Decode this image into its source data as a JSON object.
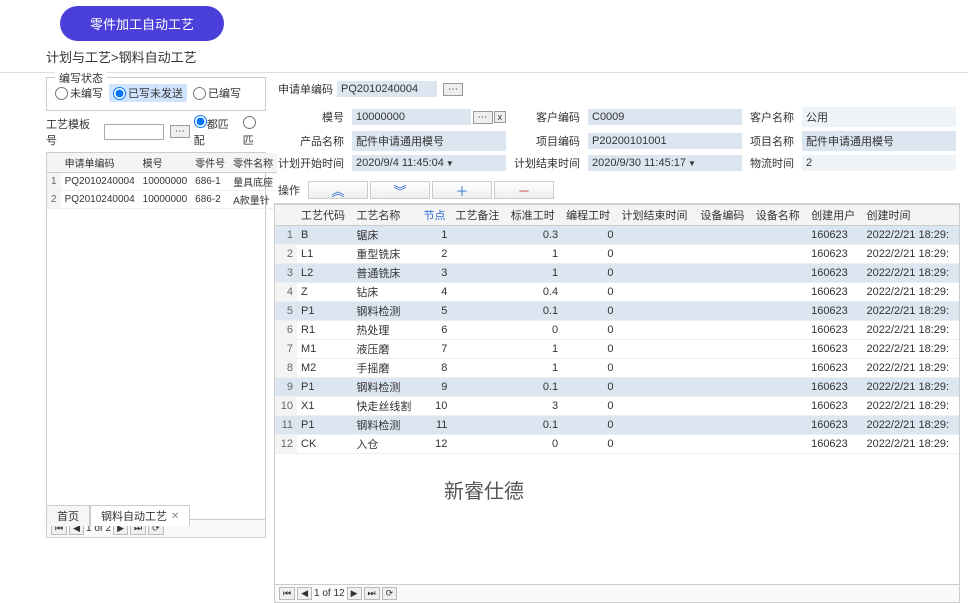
{
  "topButton": "零件加工自动工艺",
  "breadcrumb": "计划与工艺>钢料自动工艺",
  "leftPanel": {
    "statusTitle": "编写状态",
    "radios": {
      "unwritten": "未编写",
      "writtenNotSent": "已写未发送",
      "written": "已编写"
    },
    "filter": {
      "templateLabel": "工艺模板号",
      "matchAll": "都匹配",
      "other": "匹"
    },
    "columns": [
      "申请单编码",
      "模号",
      "零件号",
      "零件名称"
    ],
    "rows": [
      {
        "code": "PQ2010240004",
        "mold": "10000000",
        "part": "686-1",
        "name": "量具底座"
      },
      {
        "code": "PQ2010240004",
        "mold": "10000000",
        "part": "686-2",
        "name": "A款量针"
      }
    ],
    "pager": "1 of 2"
  },
  "form": {
    "reqCodeLabel": "申请单编码",
    "reqCode": "PQ2010240004",
    "moldLabel": "模号",
    "mold": "10000000",
    "custCodeLabel": "客户编码",
    "custCode": "C0009",
    "custNameLabel": "客户名称",
    "custName": "公用",
    "prodNameLabel": "产品名称",
    "prodName": "配件申请通用模号",
    "projCodeLabel": "项目编码",
    "projCode": "P20200101001",
    "projNameLabel": "项目名称",
    "projName": "配件申请通用模号",
    "planStartLabel": "计划开始时间",
    "planStart": "2020/9/4 11:45:04",
    "planEndLabel": "计划结束时间",
    "planEnd": "2020/9/30 11:45:17",
    "logisticsLabel": "物流时间",
    "logistics": "2"
  },
  "toolbar": {
    "opLabel": "操作"
  },
  "gridColumns": [
    "工艺代码",
    "工艺名称",
    "节点",
    "工艺备注",
    "标准工时",
    "编程工时",
    "计划结束时间",
    "设备编码",
    "设备名称",
    "创建用户",
    "创建时间"
  ],
  "gridRows": [
    {
      "alt": true,
      "code": "B",
      "name": "锯床",
      "node": "1",
      "remark": "",
      "std": "0.3",
      "prog": "0",
      "planEnd": "",
      "devCode": "",
      "devName": "",
      "user": "160623",
      "ctime": "2022/2/21 18:29:"
    },
    {
      "alt": false,
      "code": "L1",
      "name": "重型铣床",
      "node": "2",
      "remark": "",
      "std": "1",
      "prog": "0",
      "planEnd": "",
      "devCode": "",
      "devName": "",
      "user": "160623",
      "ctime": "2022/2/21 18:29:"
    },
    {
      "alt": true,
      "code": "L2",
      "name": "普通铣床",
      "node": "3",
      "remark": "",
      "std": "1",
      "prog": "0",
      "planEnd": "",
      "devCode": "",
      "devName": "",
      "user": "160623",
      "ctime": "2022/2/21 18:29:"
    },
    {
      "alt": false,
      "code": "Z",
      "name": "钻床",
      "node": "4",
      "remark": "",
      "std": "0.4",
      "prog": "0",
      "planEnd": "",
      "devCode": "",
      "devName": "",
      "user": "160623",
      "ctime": "2022/2/21 18:29:"
    },
    {
      "alt": true,
      "code": "P1",
      "name": "钢料检测",
      "node": "5",
      "remark": "",
      "std": "0.1",
      "prog": "0",
      "planEnd": "",
      "devCode": "",
      "devName": "",
      "user": "160623",
      "ctime": "2022/2/21 18:29:"
    },
    {
      "alt": false,
      "code": "R1",
      "name": "热处理",
      "node": "6",
      "remark": "",
      "std": "0",
      "prog": "0",
      "planEnd": "",
      "devCode": "",
      "devName": "",
      "user": "160623",
      "ctime": "2022/2/21 18:29:"
    },
    {
      "alt": false,
      "code": "M1",
      "name": "液压磨",
      "node": "7",
      "remark": "",
      "std": "1",
      "prog": "0",
      "planEnd": "",
      "devCode": "",
      "devName": "",
      "user": "160623",
      "ctime": "2022/2/21 18:29:"
    },
    {
      "alt": false,
      "code": "M2",
      "name": "手摇磨",
      "node": "8",
      "remark": "",
      "std": "1",
      "prog": "0",
      "planEnd": "",
      "devCode": "",
      "devName": "",
      "user": "160623",
      "ctime": "2022/2/21 18:29:"
    },
    {
      "alt": true,
      "code": "P1",
      "name": "钢料检测",
      "node": "9",
      "remark": "",
      "std": "0.1",
      "prog": "0",
      "planEnd": "",
      "devCode": "",
      "devName": "",
      "user": "160623",
      "ctime": "2022/2/21 18:29:"
    },
    {
      "alt": false,
      "code": "X1",
      "name": "快走丝线割",
      "node": "10",
      "remark": "",
      "std": "3",
      "prog": "0",
      "planEnd": "",
      "devCode": "",
      "devName": "",
      "user": "160623",
      "ctime": "2022/2/21 18:29:"
    },
    {
      "alt": true,
      "code": "P1",
      "name": "钢料检测",
      "node": "11",
      "remark": "",
      "std": "0.1",
      "prog": "0",
      "planEnd": "",
      "devCode": "",
      "devName": "",
      "user": "160623",
      "ctime": "2022/2/21 18:29:"
    },
    {
      "alt": false,
      "code": "CK",
      "name": "入仓",
      "node": "12",
      "remark": "",
      "std": "0",
      "prog": "0",
      "planEnd": "",
      "devCode": "",
      "devName": "",
      "user": "160623",
      "ctime": "2022/2/21 18:29:"
    }
  ],
  "rightPager": "1 of 12",
  "watermark": "新睿仕德",
  "tabs": {
    "home": "首页",
    "current": "钢料自动工艺"
  }
}
